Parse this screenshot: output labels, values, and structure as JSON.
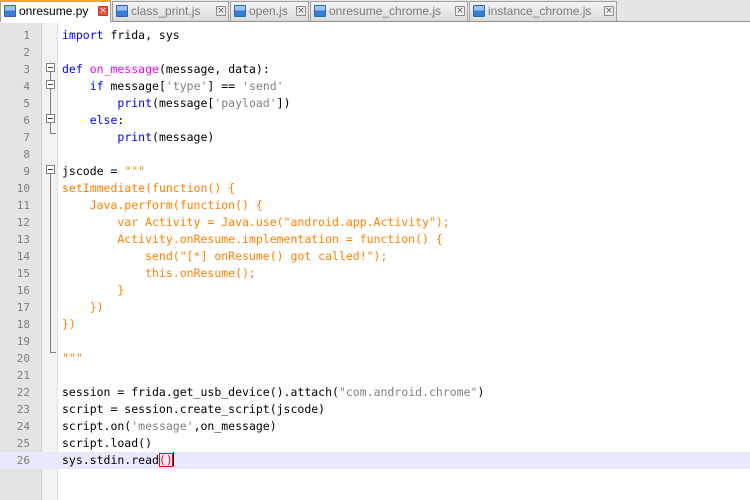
{
  "tabs": [
    {
      "label": "onresume.py",
      "active": true
    },
    {
      "label": "class_print.js",
      "active": false
    },
    {
      "label": "open.js",
      "active": false
    },
    {
      "label": "onresume_chrome.js",
      "active": false
    },
    {
      "label": "instance_chrome.js",
      "active": false
    }
  ],
  "editor": {
    "lines": [
      {
        "n": "1"
      },
      {
        "n": "2"
      },
      {
        "n": "3"
      },
      {
        "n": "4"
      },
      {
        "n": "5"
      },
      {
        "n": "6"
      },
      {
        "n": "7"
      },
      {
        "n": "8"
      },
      {
        "n": "9"
      },
      {
        "n": "10"
      },
      {
        "n": "11"
      },
      {
        "n": "12"
      },
      {
        "n": "13"
      },
      {
        "n": "14"
      },
      {
        "n": "15"
      },
      {
        "n": "16"
      },
      {
        "n": "17"
      },
      {
        "n": "18"
      },
      {
        "n": "19"
      },
      {
        "n": "20"
      },
      {
        "n": "21"
      },
      {
        "n": "22"
      },
      {
        "n": "23"
      },
      {
        "n": "24"
      },
      {
        "n": "25"
      },
      {
        "n": "26"
      }
    ],
    "code": {
      "l1": {
        "kw": "import",
        "rest": " frida, sys"
      },
      "l3": {
        "kw": "def",
        "sp": " ",
        "fn": "on_message",
        "rest": "(message, data):"
      },
      "l4": {
        "indent": "    ",
        "kw": "if",
        "a": " message[",
        "s1": "'type'",
        "b": "] == ",
        "s2": "'send'"
      },
      "l5": {
        "indent": "        ",
        "kw": "print",
        "a": "(message[",
        "s1": "'payload'",
        "b": "])"
      },
      "l6": {
        "indent": "    ",
        "kw": "else",
        "a": ":"
      },
      "l7": {
        "indent": "        ",
        "kw": "print",
        "a": "(message)"
      },
      "l9": {
        "a": "jscode = ",
        "s": "\"\"\""
      },
      "l10": "setImmediate(function() {",
      "l11": "    Java.perform(function() {",
      "l12": "        var Activity = Java.use(\"android.app.Activity\");",
      "l13": "        Activity.onResume.implementation = function() {",
      "l14": "            send(\"[*] onResume() got called!\");",
      "l15": "            this.onResume();",
      "l16": "        }",
      "l17": "    })",
      "l18": "})",
      "l20": "\"\"\"",
      "l22": {
        "a": "session = frida.get_usb_device().attach(",
        "s": "\"com.android.chrome\"",
        "b": ")"
      },
      "l23": "script = session.create_script(jscode)",
      "l24": {
        "a": "script.on(",
        "s": "'message'",
        "b": ",on_message)"
      },
      "l25": "script.load()",
      "l26": {
        "a": "sys.stdin.read",
        "b": "()"
      }
    }
  }
}
